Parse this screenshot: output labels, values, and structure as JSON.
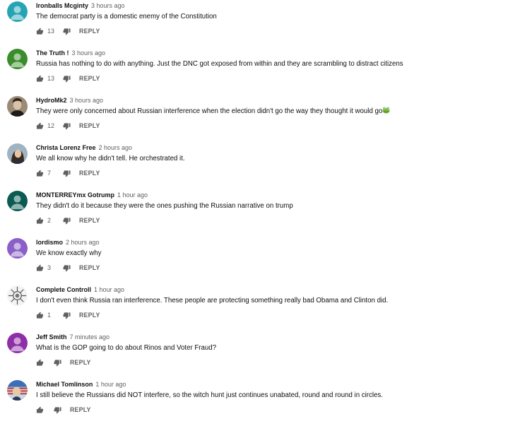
{
  "comments": [
    {
      "author": "Ironballs Mcginty",
      "time": "3 hours ago",
      "text": "The democrat party is a domestic enemy of the Constitution",
      "likes": "13",
      "reply_label": "REPLY",
      "avatar": {
        "type": "default",
        "bg": "#26a4b4"
      }
    },
    {
      "author": "The Truth !",
      "time": "3 hours ago",
      "text": "Russia has nothing to do with anything. Just the DNC got exposed from within and they are scrambling to distract citizens",
      "likes": "13",
      "reply_label": "REPLY",
      "avatar": {
        "type": "default",
        "bg": "#3b8d2c"
      }
    },
    {
      "author": "HydroMk2",
      "time": "3 hours ago",
      "text": "They were only concerned about Russian interference when the election didn't go the way they thought it would go",
      "emoji": "frog-emoji",
      "likes": "12",
      "reply_label": "REPLY",
      "avatar": {
        "type": "photo-portrait",
        "bg": "#6b5a48"
      }
    },
    {
      "author": "Christa Lorenz Free",
      "time": "2 hours ago",
      "text": "We all know why he didn't tell. He orchestrated it.",
      "likes": "7",
      "reply_label": "REPLY",
      "avatar": {
        "type": "photo-person",
        "bg": "#c8b49a"
      }
    },
    {
      "author": "MONTERREYmx Gotrump",
      "time": "1 hour ago",
      "text": "They didn't do it because they were the ones pushing the Russian narrative on trump",
      "likes": "2",
      "reply_label": "REPLY",
      "avatar": {
        "type": "default",
        "bg": "#0b5b52"
      }
    },
    {
      "author": "lordismo",
      "time": "2 hours ago",
      "text": "We know exactly why",
      "likes": "3",
      "reply_label": "REPLY",
      "avatar": {
        "type": "default",
        "bg": "#8a5fc7"
      }
    },
    {
      "author": "Complete Controll",
      "time": "1 hour ago",
      "text": "I don't even think Russia ran interference. These people are protecting something really bad Obama and Clinton did.",
      "likes": "1",
      "reply_label": "REPLY",
      "avatar": {
        "type": "photo-sketch",
        "bg": "#e8e8e8"
      }
    },
    {
      "author": "Jeff Smith",
      "time": "7 minutes ago",
      "text": "What is the GOP going to do about Rinos and Voter Fraud?",
      "likes": "",
      "reply_label": "REPLY",
      "avatar": {
        "type": "default",
        "bg": "#8e2fa8"
      }
    },
    {
      "author": "Michael Tomlinson",
      "time": "1 hour ago",
      "text": "I still believe the Russians did NOT interfere, so the witch hunt just continues unabated, round and round in circles.",
      "likes": "",
      "reply_label": "REPLY",
      "avatar": {
        "type": "photo-patriotic",
        "bg": "#3d6fb8"
      }
    }
  ],
  "colors": {
    "author": "#0f0f0f",
    "meta": "#606060",
    "icon": "#606060"
  }
}
